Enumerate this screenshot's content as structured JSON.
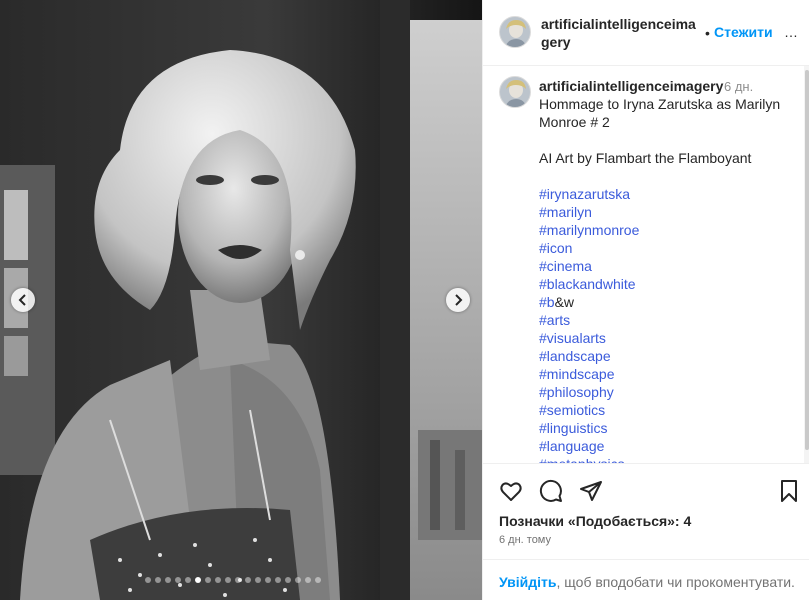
{
  "post": {
    "username": "artificialintelligenceimagery",
    "follow_label": "Стежити",
    "header_separator": "•",
    "more_label": "…",
    "time_ago": "6 дн.",
    "caption_title_lines": [
      "Hommage to Iryna Zarutska as Marilyn",
      "Monroe # 2"
    ],
    "caption_credit": "AI Art by Flambart the Flamboyant",
    "hashtags": [
      {
        "prefix": "#iryna",
        "rest": "zarutska",
        "plain": ""
      },
      {
        "prefix": "#marilyn",
        "rest": "",
        "plain": ""
      },
      {
        "prefix": "#marilyn",
        "rest": "monroe",
        "plain": ""
      },
      {
        "prefix": "#icon",
        "rest": "",
        "plain": ""
      },
      {
        "prefix": "#cinema",
        "rest": "",
        "plain": ""
      },
      {
        "prefix": "#blackandwhite",
        "rest": "",
        "plain": ""
      },
      {
        "prefix": "#b",
        "rest": "",
        "plain": "&w"
      },
      {
        "prefix": "#arts",
        "rest": "",
        "plain": ""
      },
      {
        "prefix": "#visualarts",
        "rest": "",
        "plain": ""
      },
      {
        "prefix": "#landscape",
        "rest": "",
        "plain": ""
      },
      {
        "prefix": "#mindscape",
        "rest": "",
        "plain": ""
      },
      {
        "prefix": "#philosophy",
        "rest": "",
        "plain": ""
      },
      {
        "prefix": "#semiotics",
        "rest": "",
        "plain": ""
      },
      {
        "prefix": "#linguistics",
        "rest": "",
        "plain": ""
      },
      {
        "prefix": "#language",
        "rest": "",
        "plain": ""
      },
      {
        "prefix": "#metaphysics",
        "rest": "",
        "plain": ""
      }
    ],
    "likes_text": "Позначки «Подобається»: 4",
    "date_text": "6 дн. тому",
    "login_link": "Увійдіть",
    "login_rest": ", щоб вподобати чи прокоментувати."
  },
  "carousel": {
    "dot_count": 18,
    "active_index": 5
  },
  "icons": {
    "prev": "chevron-left-icon",
    "next": "chevron-right-icon",
    "like": "heart-icon",
    "comment": "comment-bubble-icon",
    "share": "paper-plane-icon",
    "save": "bookmark-icon"
  },
  "colors": {
    "link_blue": "#0095f6",
    "hashtag": "#3b5bdb",
    "muted": "#737373"
  }
}
